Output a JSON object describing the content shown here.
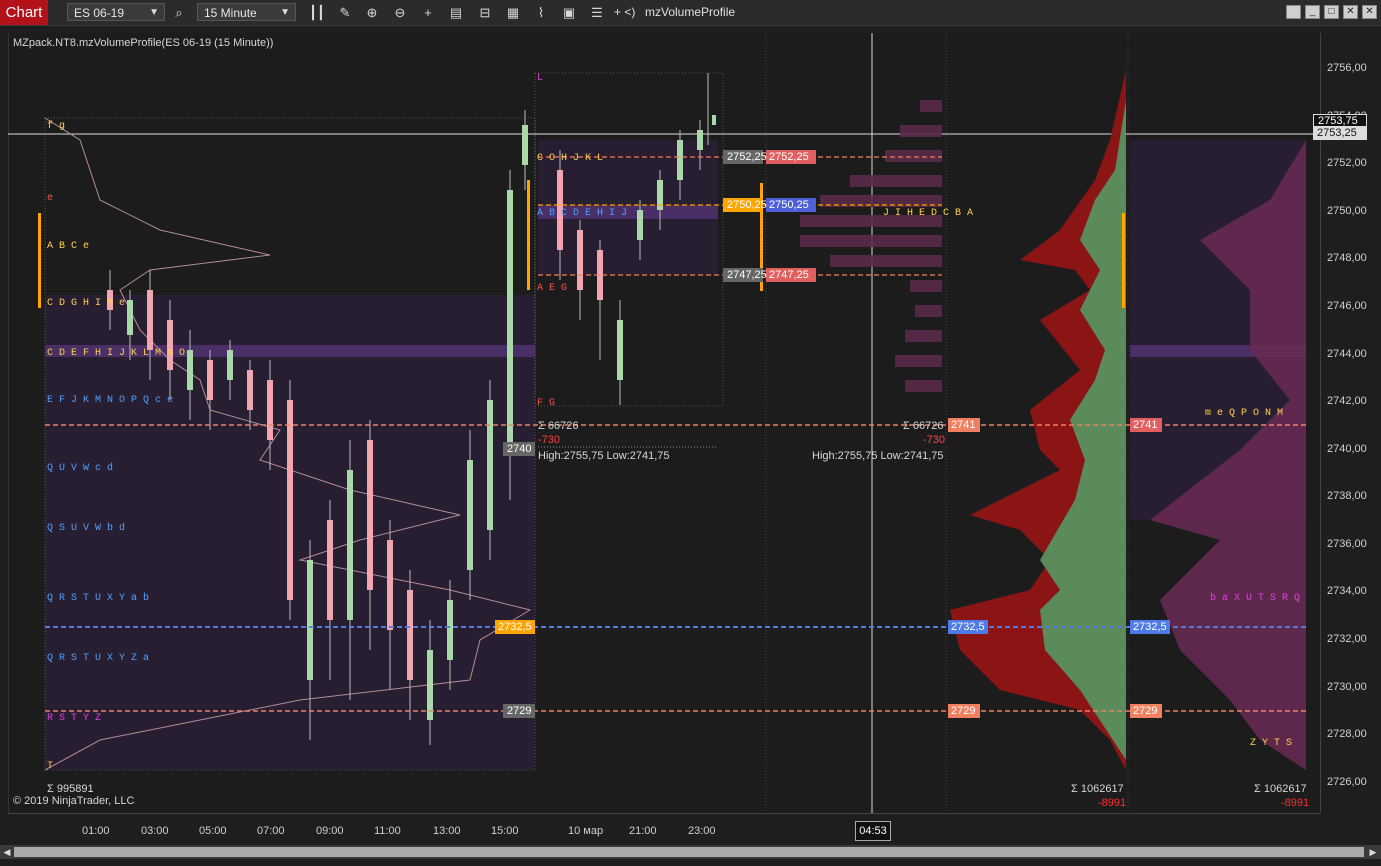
{
  "toolbar": {
    "tab_label": "Chart",
    "instrument": "ES 06-19",
    "interval": "15 Minute",
    "indicator_shortcut": "+ <)",
    "indicator_name": "mzVolumeProfile",
    "icons": [
      "search-icon",
      "bar-type-icon",
      "draw-icon",
      "zoom-in-icon",
      "zoom-out-icon",
      "crosshair-icon",
      "properties-icon",
      "data-box-icon",
      "chart-trader-icon",
      "strategy-icon",
      "template-icon",
      "more-icon"
    ]
  },
  "window_controls": [
    "restore-icon",
    "minimize-icon",
    "maximize-icon",
    "close-icon"
  ],
  "chart": {
    "title": "MZpack.NT8.mzVolumeProfile(ES 06-19 (15 Minute))",
    "copyright": "© 2019 NinjaTrader, LLC",
    "price_ticks": [
      "2756,00",
      "2754,00",
      "2752,00",
      "2750,00",
      "2748,00",
      "2746,00",
      "2744,00",
      "2742,00",
      "2740,00",
      "2738,00",
      "2736,00",
      "2734,00",
      "2732,00",
      "2730,00",
      "2728,00",
      "2726,00"
    ],
    "price_tag_current": "2753,75",
    "price_tag_last": "2753,25",
    "time_ticks": [
      "01:00",
      "03:00",
      "05:00",
      "07:00",
      "09:00",
      "11:00",
      "13:00",
      "15:00",
      "10 мар",
      "21:00",
      "23:00"
    ],
    "cursor_time": "04:53",
    "levels": {
      "vah_left": "2740",
      "poc_left": "2732,5",
      "val_left": "2729",
      "right_2752": "2752,25",
      "right_2750": "2750,25",
      "right_2747": "2747,25",
      "right_2741": "2741",
      "right_poc": "2732,5",
      "right_2729": "2729"
    },
    "stats": {
      "delta_sum": "Σ 66726",
      "delta_value": "-730",
      "high_low": "High:2755,75 Low:2741,75",
      "volume_left": "Σ 995891",
      "volume_mid": "Σ 1062617",
      "delta_mid": "-8991",
      "volume_right": "Σ 1062617",
      "delta_right": "-8991"
    },
    "colors": {
      "background": "#1c1c1c",
      "accent_red": "#b3121b",
      "poc_line": "#4f7be8",
      "level_line": "#f08060",
      "profile_dark_red": "#8b1414",
      "profile_green": "#5b8a5b",
      "value_area": "#3a2448",
      "orange": "#ffa500"
    }
  }
}
